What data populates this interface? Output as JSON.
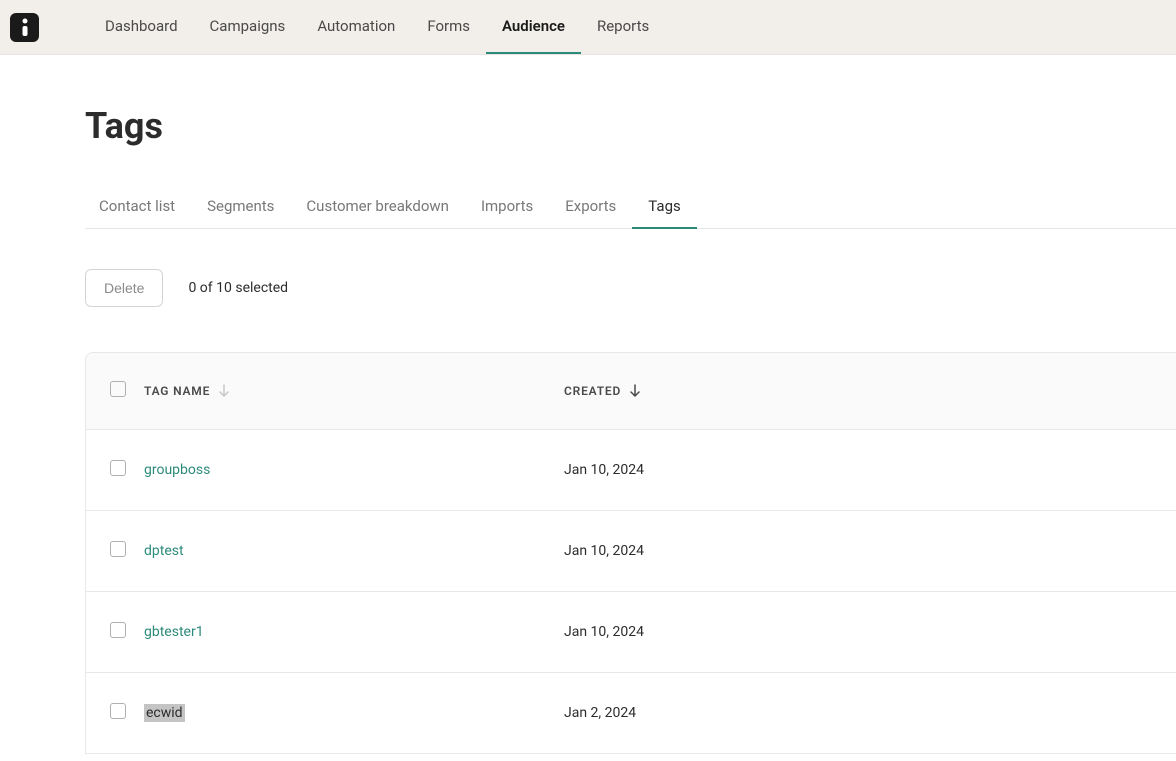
{
  "nav": {
    "items": [
      {
        "label": "Dashboard",
        "active": false
      },
      {
        "label": "Campaigns",
        "active": false
      },
      {
        "label": "Automation",
        "active": false
      },
      {
        "label": "Forms",
        "active": false
      },
      {
        "label": "Audience",
        "active": true
      },
      {
        "label": "Reports",
        "active": false
      }
    ]
  },
  "page": {
    "title": "Tags"
  },
  "subtabs": {
    "items": [
      {
        "label": "Contact list",
        "active": false
      },
      {
        "label": "Segments",
        "active": false
      },
      {
        "label": "Customer breakdown",
        "active": false
      },
      {
        "label": "Imports",
        "active": false
      },
      {
        "label": "Exports",
        "active": false
      },
      {
        "label": "Tags",
        "active": true
      }
    ]
  },
  "actions": {
    "delete_label": "Delete",
    "selection_text": "0 of 10 selected"
  },
  "table": {
    "headers": {
      "name": "TAG NAME",
      "created": "CREATED"
    },
    "rows": [
      {
        "name": "groupboss",
        "created": "Jan 10, 2024",
        "highlighted": false
      },
      {
        "name": "dptest",
        "created": "Jan 10, 2024",
        "highlighted": false
      },
      {
        "name": "gbtester1",
        "created": "Jan 10, 2024",
        "highlighted": false
      },
      {
        "name": "ecwid",
        "created": "Jan 2, 2024",
        "highlighted": true
      }
    ]
  }
}
